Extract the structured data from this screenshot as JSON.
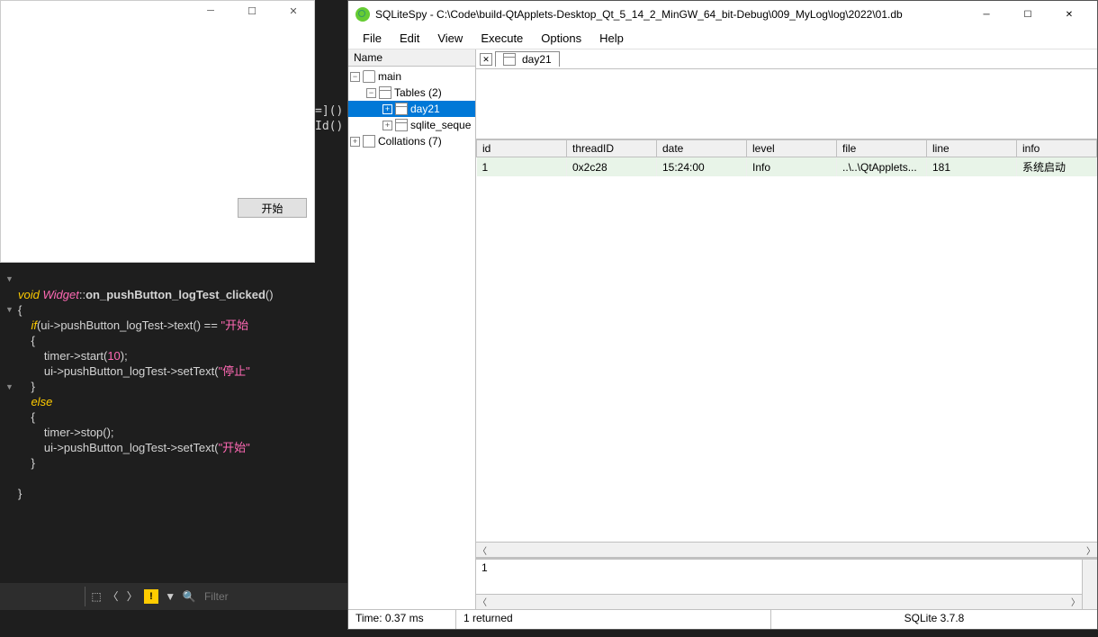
{
  "qt_dialog": {
    "button_label": "开始"
  },
  "code_fragment": "=]()\nId()",
  "code": {
    "l1_void": "void",
    "l1_widget": "Widget",
    "l1_scope": "::",
    "l1_fn": "on_pushButton_logTest_clicked",
    "l1_paren": "()",
    "l2": "{",
    "l3_if": "if",
    "l3_rest": "(ui->pushButton_logTest->text() == ",
    "l3_str": "\"开始",
    "l4": "    {",
    "l5a": "        timer->start(",
    "l5num": "10",
    "l5b": ");",
    "l6a": "        ui->pushButton_logTest->setText(",
    "l6str": "\"停止\"",
    "l7": "    }",
    "l8": "else",
    "l9": "    {",
    "l10": "        timer->stop();",
    "l11a": "        ui->pushButton_logTest->setText(",
    "l11str": "\"开始\"",
    "l12": "    }",
    "l13": "",
    "l14": "}"
  },
  "editor_footer": {
    "filter_placeholder": "Filter"
  },
  "spy": {
    "title": "SQLiteSpy - C:\\Code\\build-QtApplets-Desktop_Qt_5_14_2_MinGW_64_bit-Debug\\009_MyLog\\log\\2022\\01.db",
    "menu": [
      "File",
      "Edit",
      "View",
      "Execute",
      "Options",
      "Help"
    ],
    "tree_header": "Name",
    "tree": {
      "main": "main",
      "tables": "Tables (2)",
      "day21": "day21",
      "sqlite_seq": "sqlite_seque",
      "collations": "Collations (7)"
    },
    "tab_label": "day21",
    "columns": [
      "id",
      "threadID",
      "date",
      "level",
      "file",
      "line",
      "info"
    ],
    "rows": [
      {
        "id": "1",
        "threadID": "0x2c28",
        "date": "15:24:00",
        "level": "Info",
        "file": "..\\..\\QtApplets...",
        "line": "181",
        "info": "系统启动"
      }
    ],
    "bottom_value": "1",
    "status": {
      "time": "Time: 0.37 ms",
      "returned": "1 returned",
      "version": "SQLite 3.7.8"
    }
  }
}
